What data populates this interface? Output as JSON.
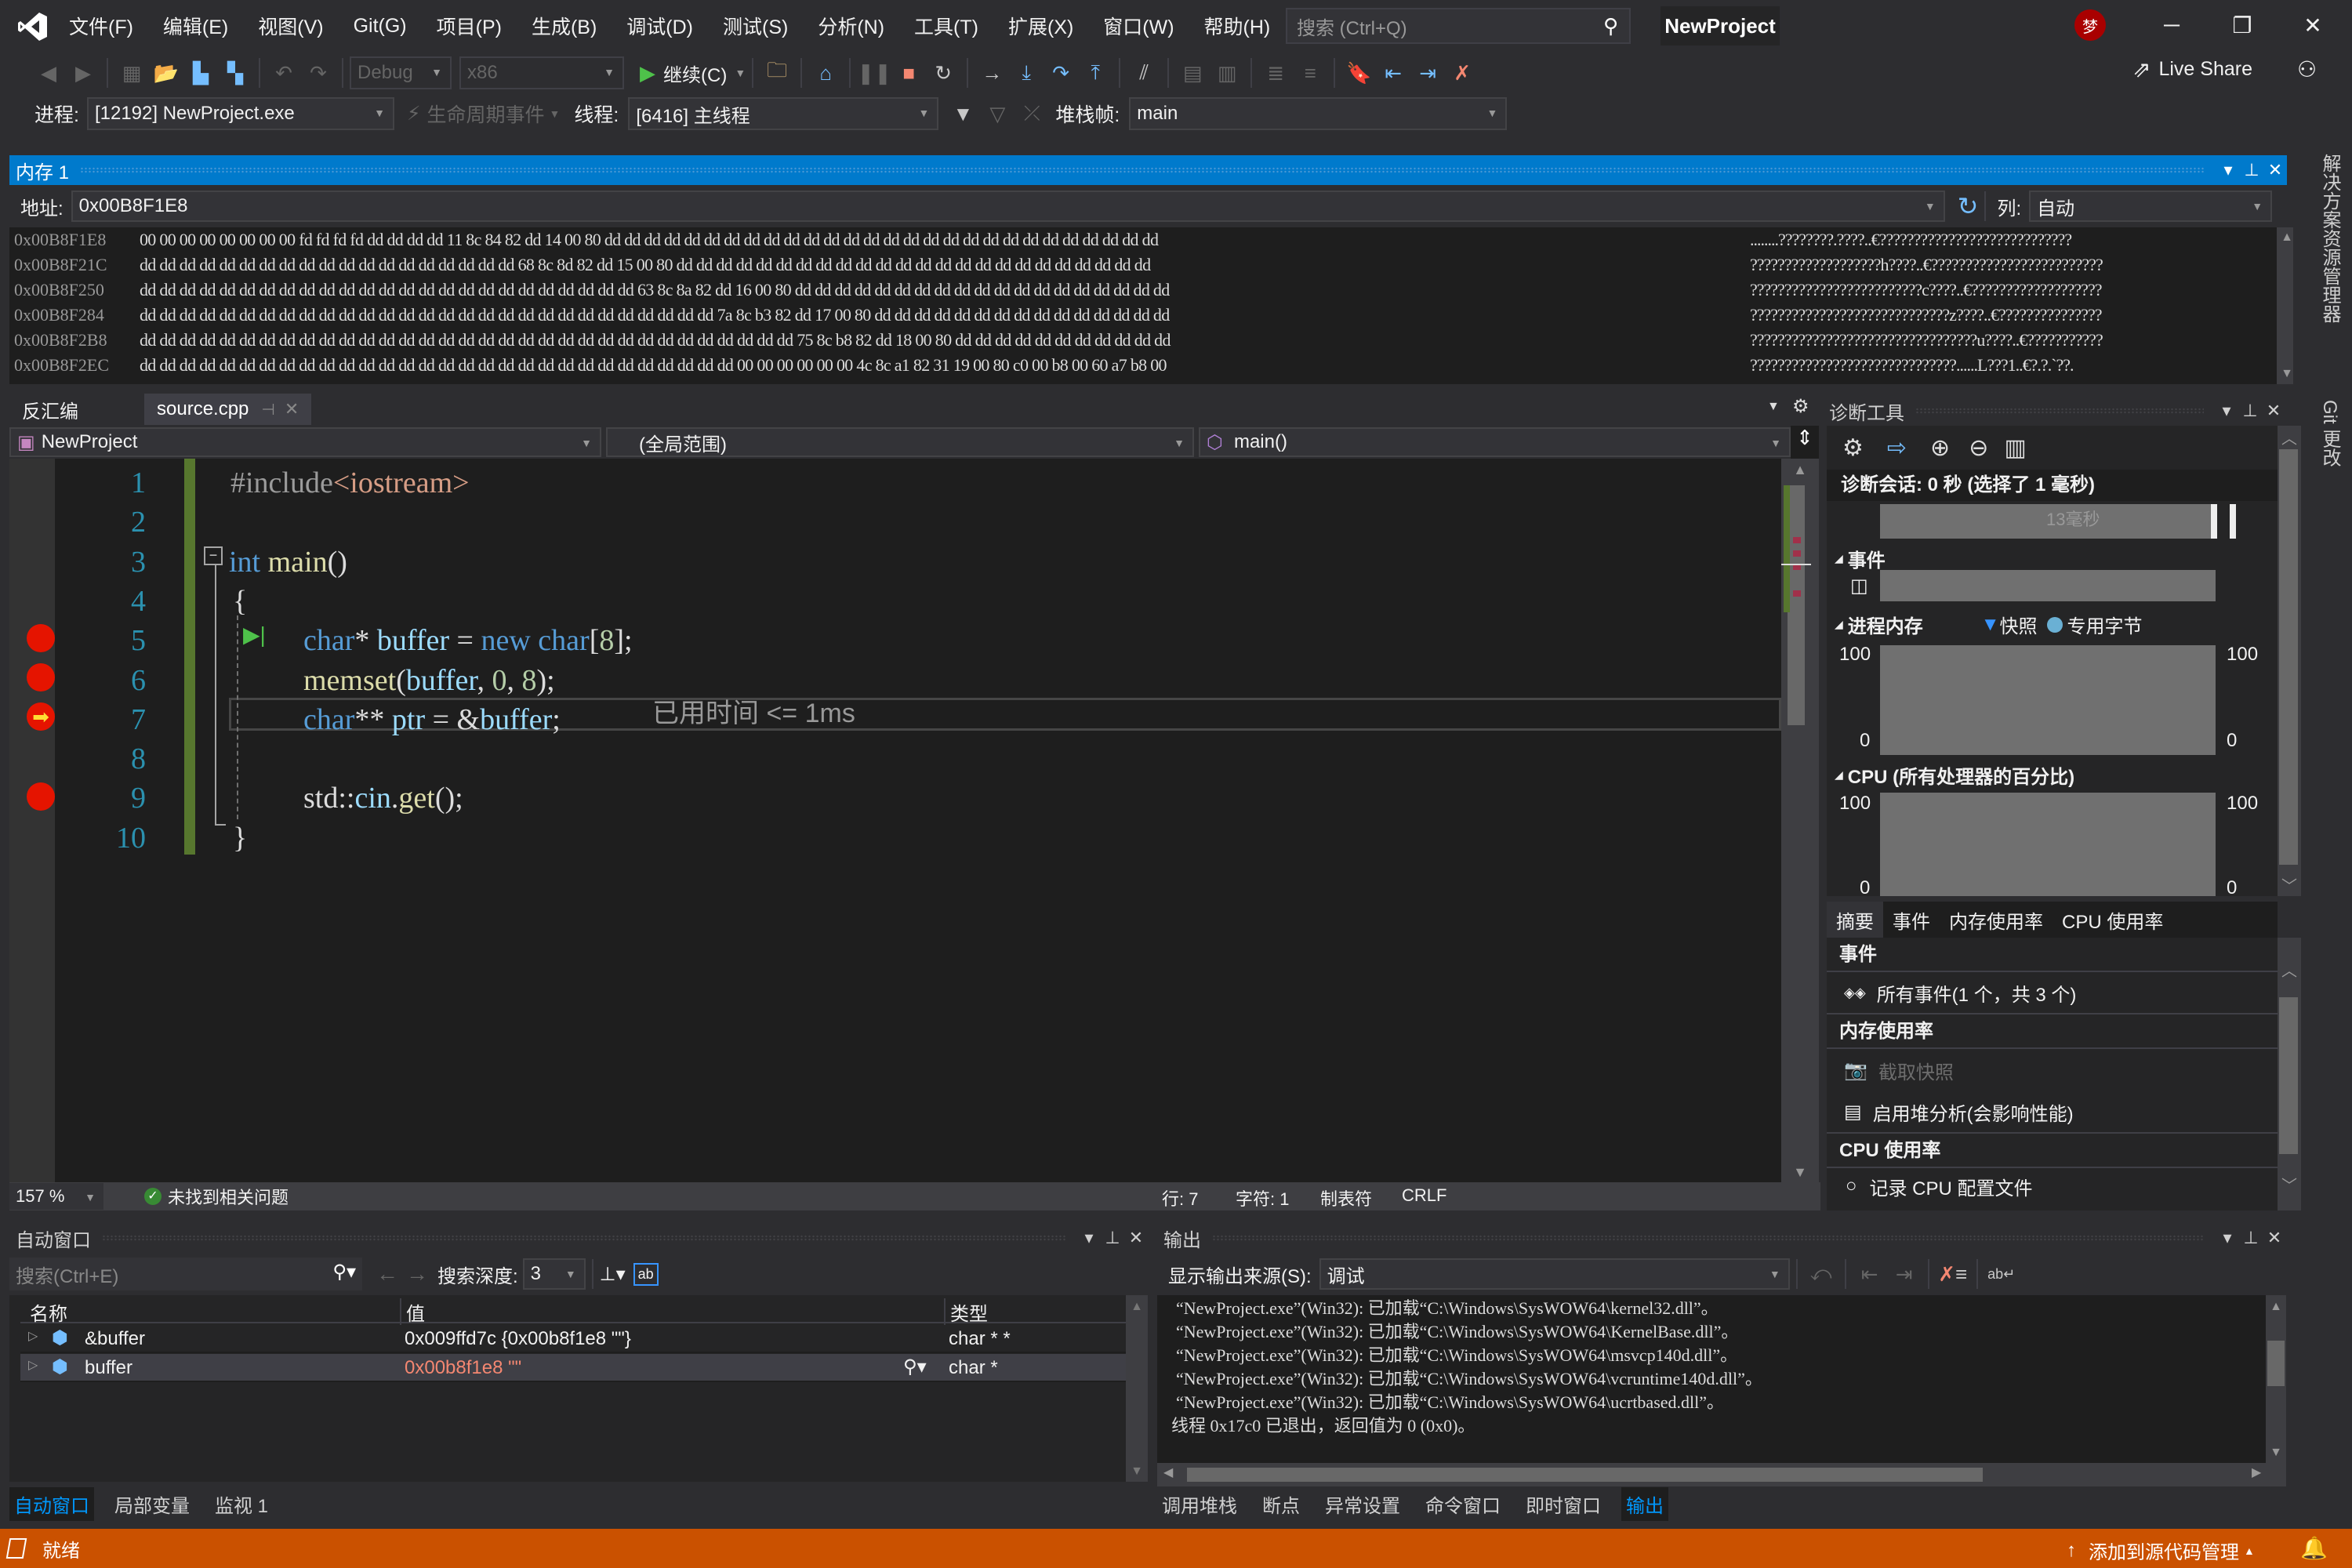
{
  "titlebar": {
    "menus": [
      "文件(F)",
      "编辑(E)",
      "视图(V)",
      "Git(G)",
      "项目(P)",
      "生成(B)",
      "调试(D)",
      "测试(S)",
      "分析(N)",
      "工具(T)",
      "扩展(X)",
      "窗口(W)",
      "帮助(H)"
    ],
    "search_placeholder": "搜索 (Ctrl+Q)",
    "project_name": "NewProject",
    "avatar_initial": "梦"
  },
  "toolbar": {
    "config": "Debug",
    "platform": "x86",
    "continue_label": "继续(C)",
    "live_share": "Live Share"
  },
  "debugbar": {
    "process_label": "进程:",
    "process_value": "[12192] NewProject.exe",
    "lifecycle_label": "生命周期事件",
    "thread_label": "线程:",
    "thread_value": "[6416] 主线程",
    "stackframe_label": "堆栈帧:",
    "stackframe_value": "main"
  },
  "memory": {
    "title": "内存 1",
    "address_label": "地址:",
    "address_value": "0x00B8F1E8",
    "columns_label": "列:",
    "columns_value": "自动",
    "rows": [
      {
        "addr": "0x00B8F1E8",
        "hex": "00 00 00 00 00 00 00 00 fd fd fd fd dd dd dd dd 11 8c 84 82 dd 14 00 80 dd dd dd dd dd dd dd dd dd dd dd dd dd dd dd dd dd dd dd dd dd dd dd dd dd dd dd dd",
        "ascii": "........????????.????..€????????????????????????????"
      },
      {
        "addr": "0x00B8F21C",
        "hex": "dd dd dd dd dd dd dd dd dd dd dd dd dd dd dd dd dd dd dd 68 8c 8d 82 dd 15 00 80 dd dd dd dd dd dd dd dd dd dd dd dd dd dd dd dd dd dd dd dd dd dd dd dd",
        "ascii": "???????????????????h????..€?????????????????????????"
      },
      {
        "addr": "0x00B8F250",
        "hex": "dd dd dd dd dd dd dd dd dd dd dd dd dd dd dd dd dd dd dd dd dd dd dd dd dd 63 8c 8a 82 dd 16 00 80 dd dd dd dd dd dd dd dd dd dd dd dd dd dd dd dd dd dd dd",
        "ascii": "?????????????????????????c????..€???????????????????"
      },
      {
        "addr": "0x00B8F284",
        "hex": "dd dd dd dd dd dd dd dd dd dd dd dd dd dd dd dd dd dd dd dd dd dd dd dd dd dd dd dd dd 7a 8c b3 82 dd 17 00 80 dd dd dd dd dd dd dd dd dd dd dd dd dd dd dd",
        "ascii": "?????????????????????????????z????..€???????????????"
      },
      {
        "addr": "0x00B8F2B8",
        "hex": "dd dd dd dd dd dd dd dd dd dd dd dd dd dd dd dd dd dd dd dd dd dd dd dd dd dd dd dd dd dd dd dd dd 75 8c b8 82 dd 18 00 80 dd dd dd dd dd dd dd dd dd dd dd",
        "ascii": "?????????????????????????????????u????..€???????????"
      },
      {
        "addr": "0x00B8F2EC",
        "hex": "dd dd dd dd dd dd dd dd dd dd dd dd dd dd dd dd dd dd dd dd dd dd dd dd dd dd dd dd dd dd 00 00 00 00 00 00 4c 8c a1 82 31 19 00 80 c0 00 b8 00 60 a7 b8 00",
        "ascii": "??????????????????????????????......L???1..€?.?.`??."
      }
    ]
  },
  "editor": {
    "tabs": [
      {
        "label": "反汇编"
      },
      {
        "label": "source.cpp"
      }
    ],
    "nav_project": "NewProject",
    "nav_scope": "(全局范围)",
    "nav_member": "main()",
    "zoom": "157 %",
    "issues": "未找到相关问题",
    "line": "行: 7",
    "char": "字符: 1",
    "indent": "制表符",
    "eol": "CRLF",
    "perf_tip": "已用时间 <= 1ms",
    "lines": [
      {
        "n": "1",
        "tokens": [
          {
            "t": "#include",
            "c": "pp"
          },
          {
            "t": "<iostream>",
            "c": "str"
          }
        ]
      },
      {
        "n": "2",
        "tokens": []
      },
      {
        "n": "3",
        "tokens": [
          {
            "t": "int ",
            "c": "kw"
          },
          {
            "t": "main",
            "c": "fn"
          },
          {
            "t": "()",
            "c": "pl"
          }
        ]
      },
      {
        "n": "4",
        "tokens": [
          {
            "t": "{",
            "c": "pl"
          }
        ]
      },
      {
        "n": "5",
        "tokens": [
          {
            "t": "char",
            "c": "kw"
          },
          {
            "t": "* ",
            "c": "pl"
          },
          {
            "t": "buffer",
            "c": "var"
          },
          {
            "t": " = ",
            "c": "pl"
          },
          {
            "t": "new ",
            "c": "kw"
          },
          {
            "t": "char",
            "c": "kw"
          },
          {
            "t": "[",
            "c": "pl"
          },
          {
            "t": "8",
            "c": "num"
          },
          {
            "t": "];",
            "c": "pl"
          }
        ]
      },
      {
        "n": "6",
        "tokens": [
          {
            "t": "memset",
            "c": "fn"
          },
          {
            "t": "(",
            "c": "pl"
          },
          {
            "t": "buffer",
            "c": "var"
          },
          {
            "t": ", ",
            "c": "pl"
          },
          {
            "t": "0",
            "c": "num"
          },
          {
            "t": ", ",
            "c": "pl"
          },
          {
            "t": "8",
            "c": "num"
          },
          {
            "t": ");",
            "c": "pl"
          }
        ]
      },
      {
        "n": "7",
        "tokens": [
          {
            "t": "char",
            "c": "kw"
          },
          {
            "t": "** ",
            "c": "pl"
          },
          {
            "t": "ptr",
            "c": "var"
          },
          {
            "t": " = &",
            "c": "pl"
          },
          {
            "t": "buffer",
            "c": "var"
          },
          {
            "t": ";",
            "c": "pl"
          }
        ]
      },
      {
        "n": "8",
        "tokens": []
      },
      {
        "n": "9",
        "tokens": [
          {
            "t": "std",
            "c": "pl"
          },
          {
            "t": "::",
            "c": "pl"
          },
          {
            "t": "cin",
            "c": "var"
          },
          {
            "t": ".",
            "c": "pl"
          },
          {
            "t": "get",
            "c": "fn"
          },
          {
            "t": "();",
            "c": "pl"
          }
        ]
      },
      {
        "n": "10",
        "tokens": [
          {
            "t": "}",
            "c": "pl"
          }
        ]
      }
    ]
  },
  "diagnostics": {
    "title": "诊断工具",
    "session": "诊断会话: 0 秒 (选择了 1 毫秒)",
    "timeline_label": "13毫秒",
    "events_label": "事件",
    "process_memory_label": "进程内存",
    "legend_snapshot": "快照",
    "legend_private_bytes": "专用字节",
    "mem_ymax": "100",
    "mem_ymin": "0",
    "cpu_label": "CPU (所有处理器的百分比)",
    "cpu_ymax": "100",
    "cpu_ymin": "0",
    "tabs": [
      "摘要",
      "事件",
      "内存使用率",
      "CPU 使用率"
    ],
    "summary": {
      "events_head": "事件",
      "all_events": "所有事件(1 个，共 3 个)",
      "memory_head": "内存使用率",
      "take_snapshot": "截取快照",
      "heap_profiling": "启用堆分析(会影响性能)",
      "cpu_head": "CPU 使用率",
      "record_cpu": "记录 CPU 配置文件"
    }
  },
  "autos": {
    "title": "自动窗口",
    "search_placeholder": "搜索(Ctrl+E)",
    "depth_label": "搜索深度:",
    "depth_value": "3",
    "columns": [
      "名称",
      "值",
      "类型"
    ],
    "rows": [
      {
        "name": "&buffer",
        "value": "0x009ffd7c {0x00b8f1e8 \"\"}",
        "type": "char * *",
        "changed": false
      },
      {
        "name": "buffer",
        "value": "0x00b8f1e8 \"\"",
        "type": "char *",
        "changed": true
      }
    ],
    "bottom_tabs": [
      "自动窗口",
      "局部变量",
      "监视 1"
    ]
  },
  "output": {
    "title": "输出",
    "source_label": "显示输出来源(S):",
    "source_value": "调试",
    "lines": [
      "“NewProject.exe”(Win32): 已加载“C:\\Windows\\SysWOW64\\kernel32.dll”。",
      "“NewProject.exe”(Win32): 已加载“C:\\Windows\\SysWOW64\\KernelBase.dll”。",
      "“NewProject.exe”(Win32): 已加载“C:\\Windows\\SysWOW64\\msvcp140d.dll”。",
      "“NewProject.exe”(Win32): 已加载“C:\\Windows\\SysWOW64\\vcruntime140d.dll”。",
      "“NewProject.exe”(Win32): 已加载“C:\\Windows\\SysWOW64\\ucrtbased.dll”。",
      "线程 0x17c0 已退出，返回值为 0 (0x0)。"
    ],
    "bottom_tabs": [
      "调用堆栈",
      "断点",
      "异常设置",
      "命令窗口",
      "即时窗口",
      "输出"
    ]
  },
  "side_tabs": [
    "解决方案资源管理器",
    "Git 更改"
  ],
  "statusbar": {
    "status": "就绪",
    "source_control": "添加到源代码管理"
  },
  "colors": {
    "accent": "#007acc",
    "status": "#ca5100",
    "breakpoint": "#e51400"
  }
}
